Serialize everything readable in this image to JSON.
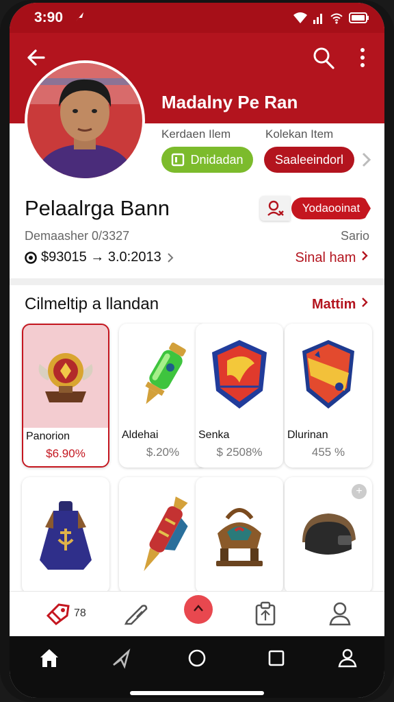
{
  "status_bar": {
    "time": "3:90"
  },
  "header": {
    "profile_name": "Madalny Pe Ran",
    "stats": [
      {
        "label": "Kerdaen Ilem",
        "button": "Dnidadan",
        "color": "#7cbb2c"
      },
      {
        "label": "Kolekan Item",
        "button": "Saaleeindorl",
        "color": "#b3141e"
      }
    ]
  },
  "profile": {
    "title": "Pelaalrga Bann",
    "follow_label": "Yodaooinat",
    "member_label": "Demaasher 0/3327",
    "side_label": "Sario",
    "balance": "$93015 → 3.0:2013",
    "side_link": "Sinal ham"
  },
  "section": {
    "title": "Cilmeltip a llandan",
    "link": "Mattim"
  },
  "items": [
    {
      "name": "Panorion",
      "price": "$6.90%",
      "icon": "trophy-icon",
      "selected": true
    },
    {
      "name": "Aldehai",
      "price": "$.20%",
      "icon": "potion-icon",
      "selected": false
    },
    {
      "name": "Senka",
      "price": "$ 2508%",
      "icon": "shield-crest-icon",
      "selected": false
    },
    {
      "name": "Dlurinan",
      "price": "455 %",
      "icon": "team-shield-icon",
      "selected": false
    },
    {
      "name": "",
      "price": "",
      "icon": "robe-icon",
      "selected": false
    },
    {
      "name": "",
      "price": "",
      "icon": "horn-icon",
      "selected": false
    },
    {
      "name": "",
      "price": "",
      "icon": "saddle-icon",
      "selected": false
    },
    {
      "name": "",
      "price": "",
      "icon": "helmet-icon",
      "selected": false
    }
  ],
  "tab_bar": {
    "tabs": [
      {
        "icon": "tag-icon",
        "count": "78"
      },
      {
        "icon": "edit-icon"
      },
      {
        "icon": "heart-icon",
        "active": true
      },
      {
        "icon": "clipboard-icon"
      },
      {
        "icon": "profile-icon"
      }
    ]
  },
  "colors": {
    "brand_red": "#b3141e",
    "accent_green": "#7cbb2c"
  }
}
